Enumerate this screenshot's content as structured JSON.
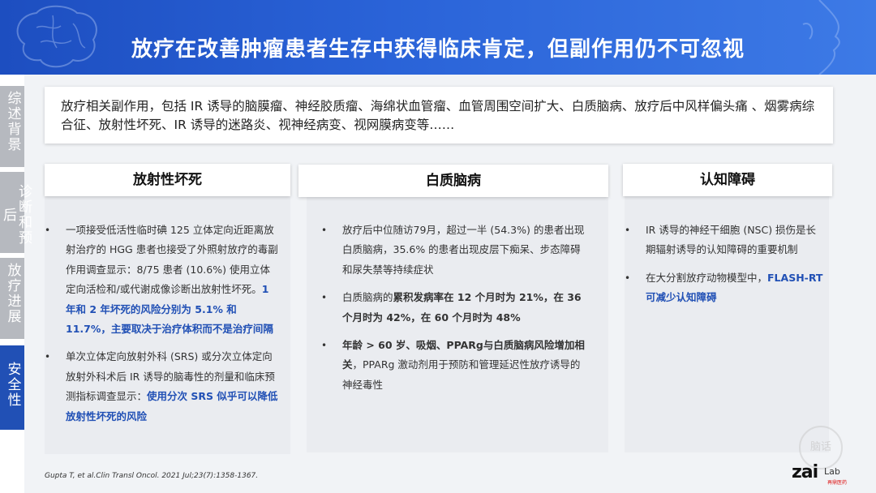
{
  "header": {
    "title": "放疗在改善肿瘤患者生存中获得临床肯定，但副作用仍不可忽视"
  },
  "sidebar": {
    "tabs": [
      {
        "label": "综述背景",
        "active": false
      },
      {
        "label": "诊断和预后",
        "active": false
      },
      {
        "label": "放疗进展",
        "active": false
      },
      {
        "label": "安全性",
        "active": true
      }
    ]
  },
  "intro": {
    "text": "放疗相关副作用，包括 IR 诱导的脑膜瘤、神经胶质瘤、海绵状血管瘤、血管周围空间扩大、白质脑病、放疗后中风样偏头痛 、烟雾病综合征、放射性坏死、IR 诱导的迷路炎、视神经病变、视网膜病变等……"
  },
  "columns": [
    {
      "title": "放射性坏死",
      "items": [
        {
          "plain": "一项接受低活性临时碘 125 立体定向近距离放射治疗的 HGG 患者也接受了外照射放疗的毒副作用调查显示：8/75 患者 (10.6%) 使用立体定向活检和/或代谢成像诊断出放射性坏死。",
          "highlight": "1 年和 2 年坏死的风险分别为 5.1% 和 11.7%，主要取决于治疗体积而不是治疗间隔"
        },
        {
          "plain": "单次立体定向放射外科 (SRS) 或分次立体定向放射外科术后 IR 诱导的脑毒性的剂量和临床预测指标调查显示：",
          "highlight": "使用分次 SRS 似乎可以降低放射性坏死的风险"
        }
      ]
    },
    {
      "title": "白质脑病",
      "items": [
        {
          "plain": "放疗后中位随访79月，超过一半 (54.3%) 的患者出现白质脑病，35.6% 的患者出现皮层下痴呆、步态障碍和尿失禁等持续症状"
        },
        {
          "prefix": "白质脑病的",
          "bold": "累积发病率在 12 个月时为 21%，在 36 个月时为 42%，在 60 个月时为 48%"
        },
        {
          "bold": "年龄 > 60 岁、吸烟、PPARg与白质脑病风险增加相关",
          "plain": "，PPARg 激动剂用于预防和管理延迟性放疗诱导的神经毒性"
        }
      ]
    },
    {
      "title": "认知障碍",
      "items": [
        {
          "plain": "IR 诱导的神经干细胞 (NSC) 损伤是长期辐射诱导的认知障碍的重要机制"
        },
        {
          "plain": "在大分割放疗动物模型中，",
          "highlight": "FLASH-RT可减少认知障碍"
        }
      ]
    }
  ],
  "citation": "Gupta T, et al.Clin Transl Oncol. 2021 Jul;23(7):1358-1367.",
  "logo": {
    "text": "zai",
    "sub": "Lab",
    "cn": "再鼎医药"
  },
  "watermark": "脑话"
}
